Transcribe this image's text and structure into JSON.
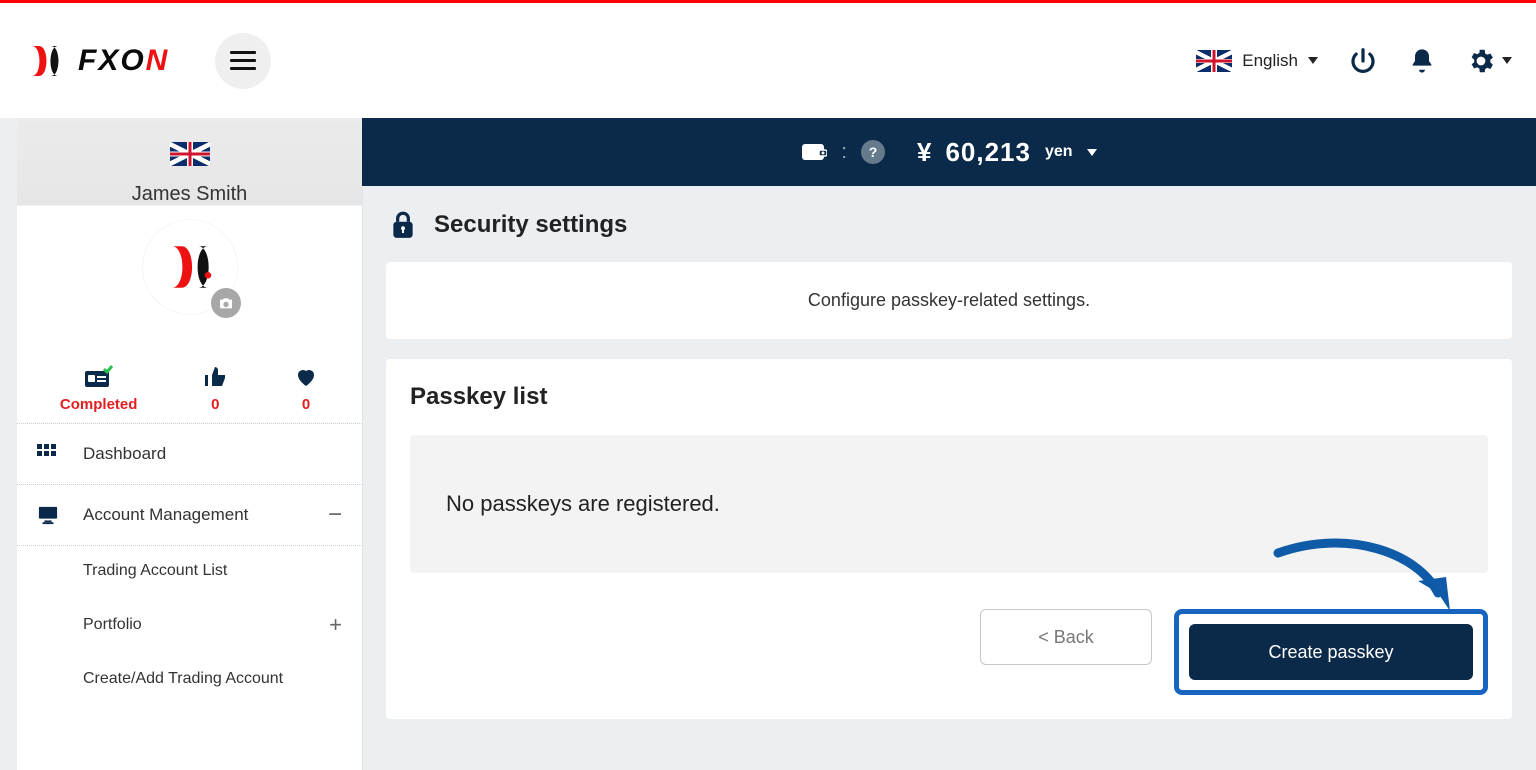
{
  "header": {
    "logo_text_1": "FXO",
    "logo_text_2": "N",
    "lang_label": "English"
  },
  "balance": {
    "symbol": "¥",
    "amount": "60,213",
    "currency": "yen"
  },
  "sidebar": {
    "user_name": "James Smith",
    "stats": {
      "completed_label": "Completed",
      "likes": "0",
      "hearts": "0"
    },
    "menu": {
      "dashboard": "Dashboard",
      "account_mgmt": "Account Management",
      "sub": {
        "trading_list": "Trading Account List",
        "portfolio": "Portfolio",
        "create_add": "Create/Add Trading Account"
      }
    }
  },
  "main": {
    "section_title": "Security settings",
    "description": "Configure passkey-related settings.",
    "list_title": "Passkey list",
    "empty_msg": "No passkeys are registered.",
    "back_btn": "< Back",
    "create_btn": "Create passkey"
  }
}
